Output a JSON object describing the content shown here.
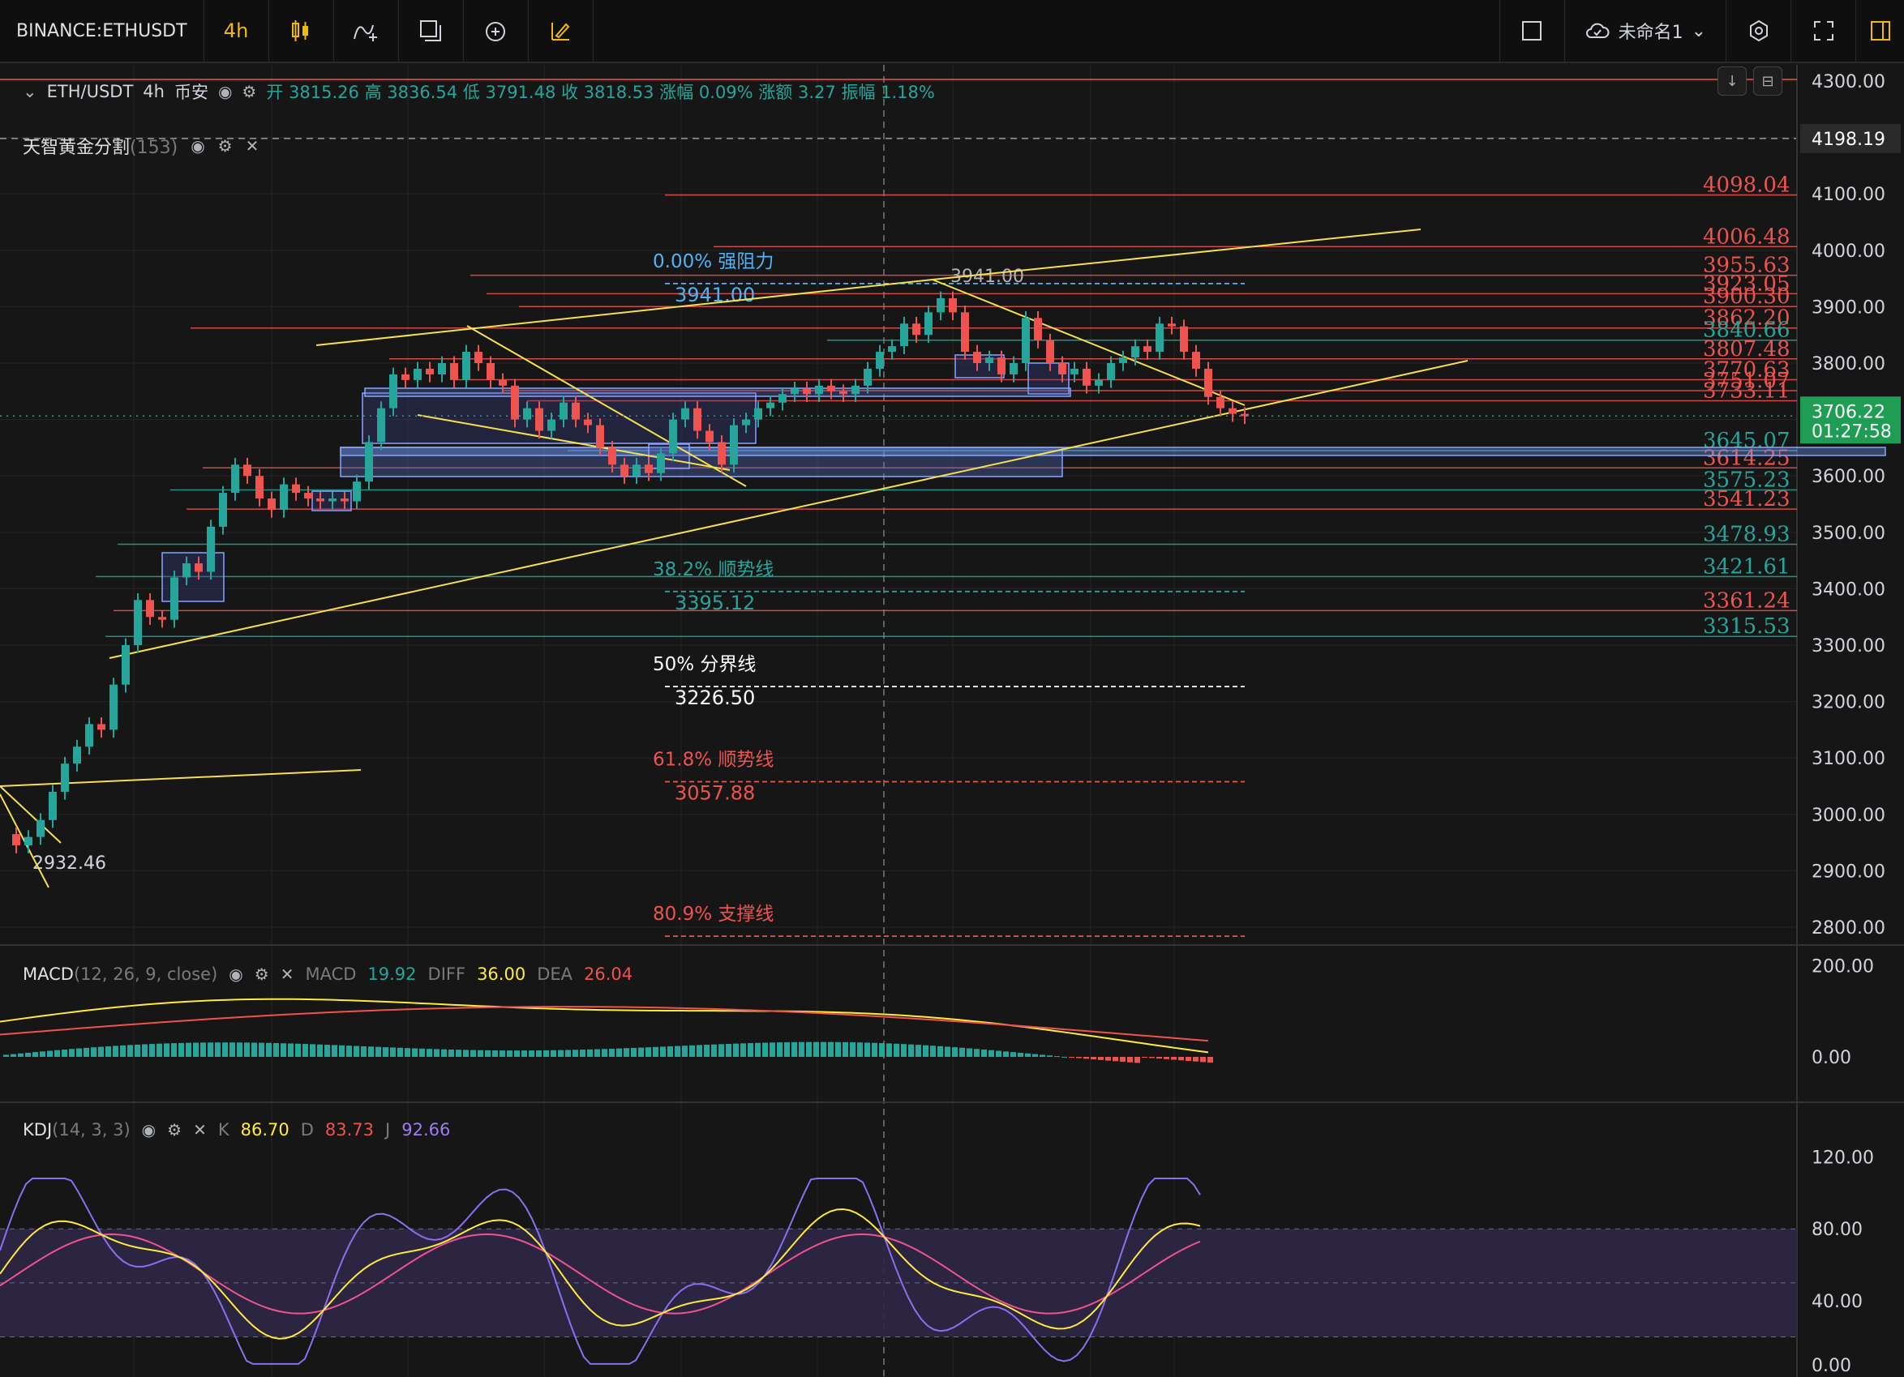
{
  "toolbar": {
    "symbol": "BINANCE:ETHUSDT",
    "interval": "4h",
    "layout_name": "未命名1"
  },
  "legend": {
    "pair": "ETH/USDT",
    "interval": "4h",
    "exchange": "币安",
    "open_label": "开",
    "open": "3815.26",
    "high_label": "高",
    "high": "3836.54",
    "low_label": "低",
    "low": "3791.48",
    "close_label": "收",
    "close": "3818.53",
    "change_pct_label": "涨幅",
    "change_pct": "0.09%",
    "change_label": "涨额",
    "change": "3.27",
    "amplitude_label": "振幅",
    "amplitude": "1.18%"
  },
  "indicator": {
    "name": "天智黄金分割",
    "param": "(153)"
  },
  "price_axis": {
    "ticks": [
      "4300.00",
      "4100.00",
      "4000.00",
      "3900.00",
      "3800.00",
      "3600.00",
      "3500.00",
      "3400.00",
      "3300.00",
      "3200.00",
      "3100.00",
      "3000.00",
      "2900.00",
      "2800.00"
    ],
    "tick_values": [
      4300,
      4100,
      4000,
      3900,
      3800,
      3600,
      3500,
      3400,
      3300,
      3200,
      3100,
      3000,
      2900,
      2800
    ],
    "marker_label": "4198.19",
    "marker_value": 4198.19,
    "current_price": "3706.22",
    "countdown": "01:27:58",
    "current_value": 3706.22
  },
  "levels": [
    {
      "label": "4098.04",
      "value": 4098.04,
      "color": "#ef5350"
    },
    {
      "label": "4006.48",
      "value": 4006.48,
      "color": "#ef5350"
    },
    {
      "label": "3955.63",
      "value": 3955.63,
      "color": "#ef5350"
    },
    {
      "label": "3923.05",
      "value": 3923.05,
      "color": "#ef5350"
    },
    {
      "label": "3900.30",
      "value": 3900.3,
      "color": "#ef5350"
    },
    {
      "label": "3862.20",
      "value": 3862.2,
      "color": "#ef5350"
    },
    {
      "label": "3840.66",
      "value": 3840.66,
      "color": "#26a69a"
    },
    {
      "label": "3807.48",
      "value": 3807.48,
      "color": "#ef5350"
    },
    {
      "label": "3770.63",
      "value": 3770.63,
      "color": "#ef5350"
    },
    {
      "label": "3751.07",
      "value": 3751.07,
      "color": "#ef5350"
    },
    {
      "label": "3733.11",
      "value": 3733.11,
      "color": "#ef5350"
    },
    {
      "label": "3645.07",
      "value": 3645.07,
      "color": "#26a69a"
    },
    {
      "label": "3614.25",
      "value": 3614.25,
      "color": "#ef5350"
    },
    {
      "label": "3575.23",
      "value": 3575.23,
      "color": "#26a69a"
    },
    {
      "label": "3541.23",
      "value": 3541.23,
      "color": "#ef5350"
    },
    {
      "label": "3478.93",
      "value": 3478.93,
      "color": "#26a69a"
    },
    {
      "label": "3421.61",
      "value": 3421.61,
      "color": "#26a69a"
    },
    {
      "label": "3361.24",
      "value": 3361.24,
      "color": "#ef5350"
    },
    {
      "label": "3315.53",
      "value": 3315.53,
      "color": "#26a69a"
    }
  ],
  "fib": [
    {
      "pct": "0.00% 强阻力",
      "price": "3941.00",
      "value": 3941.0,
      "color": "#4fb3f6"
    },
    {
      "pct": "38.2% 顺势线",
      "price": "3395.12",
      "value": 3395.12,
      "color": "#26a69a"
    },
    {
      "pct": "50% 分界线",
      "price": "3226.50",
      "value": 3226.5,
      "color": "#ffffff"
    },
    {
      "pct": "61.8% 顺势线",
      "price": "3057.88",
      "value": 3057.88,
      "color": "#ef5350"
    },
    {
      "pct": "80.9% 支撑线",
      "price": "",
      "value": 2784,
      "color": "#ef5350"
    }
  ],
  "annotations": {
    "high": "3941.00",
    "low": "2932.46"
  },
  "macd": {
    "name": "MACD",
    "params": "(12, 26, 9, close)",
    "macd_label": "MACD",
    "macd": "19.92",
    "diff_label": "DIFF",
    "diff": "36.00",
    "dea_label": "DEA",
    "dea": "26.04",
    "ticks": [
      "200.00",
      "0.00"
    ]
  },
  "kdj": {
    "name": "KDJ",
    "params": "(14, 3, 3)",
    "k_label": "K",
    "k": "86.70",
    "d_label": "D",
    "d": "83.73",
    "j_label": "J",
    "j": "92.66",
    "ticks": [
      "120.00",
      "80.00",
      "40.00",
      "0.00"
    ]
  },
  "colors": {
    "up": "#26a69a",
    "down": "#ef5350",
    "accent": "#f0b90b",
    "trend": "#f5e050"
  }
}
